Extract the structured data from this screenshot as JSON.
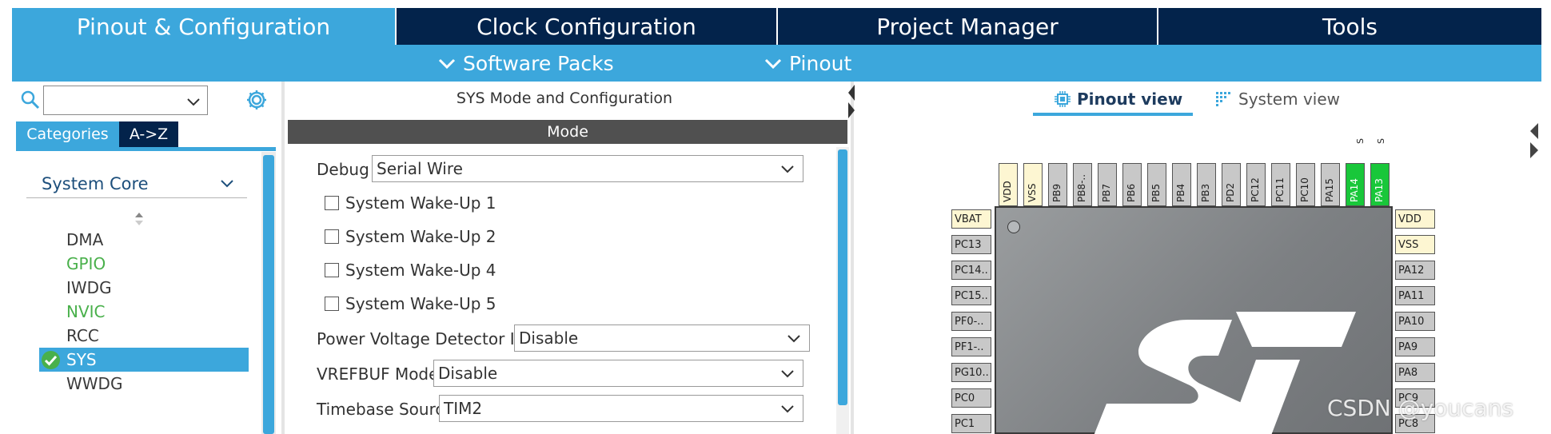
{
  "top_tabs": [
    {
      "label": "Pinout & Configuration"
    },
    {
      "label": "Clock Configuration"
    },
    {
      "label": "Project Manager"
    },
    {
      "label": "Tools"
    }
  ],
  "sub_menus": [
    {
      "label": "Software Packs"
    },
    {
      "label": "Pinout"
    }
  ],
  "left": {
    "search": {
      "value": "",
      "placeholder": ""
    },
    "tabs": [
      "Categories",
      "A->Z"
    ],
    "group": "System Core",
    "items": [
      "DMA",
      "GPIO",
      "IWDG",
      "NVIC",
      "RCC",
      "SYS",
      "WWDG"
    ]
  },
  "middle": {
    "title": "SYS Mode and Configuration",
    "mode_header": "Mode",
    "debug": {
      "label": "Debug",
      "value": "Serial Wire"
    },
    "wakeups": [
      "System Wake-Up 1",
      "System Wake-Up 2",
      "System Wake-Up 4",
      "System Wake-Up 5"
    ],
    "pvd": {
      "label": "Power Voltage Detector In",
      "value": "Disable"
    },
    "vrefbuf": {
      "label": "VREFBUF Mode",
      "value": "Disable"
    },
    "timebase": {
      "label": "Timebase Source",
      "value": "TIM2"
    }
  },
  "right": {
    "view_tabs": [
      "Pinout view",
      "System view"
    ],
    "top_marks": [
      "S",
      "S"
    ],
    "top_pins": [
      "VDD",
      "VSS",
      "PB9",
      "PB8-..",
      "PB7",
      "PB6",
      "PB5",
      "PB4",
      "PB3",
      "PD2",
      "PC12",
      "PC11",
      "PC10",
      "PA15",
      "PA14",
      "PA13"
    ],
    "left_pins": [
      "VBAT",
      "PC13",
      "PC14..",
      "PC15..",
      "PF0-..",
      "PF1-..",
      "PG10..",
      "PC0",
      "PC1"
    ],
    "right_pins": [
      "VDD",
      "VSS",
      "PA12",
      "PA11",
      "PA10",
      "PA9",
      "PA8",
      "PC9",
      "PC8"
    ]
  },
  "colors": {
    "navy": "#03234b",
    "accent_blue": "#3ca7dc",
    "pin_green": "#19c73a",
    "pin_power": "#fdf6d2",
    "pin_gray": "#c8c8c8"
  },
  "watermark": "CSDN @youcans"
}
